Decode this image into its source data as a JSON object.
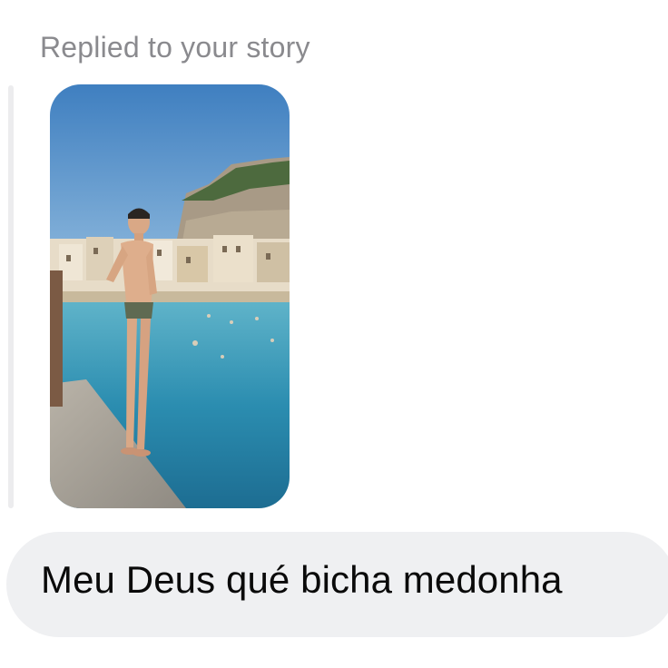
{
  "reply": {
    "header": "Replied to your story"
  },
  "story": {
    "thumbnail_icon": "story-photo-icon",
    "scene": "person standing on stone pier beside clear blue sea, town and rocky cliff in background"
  },
  "message": {
    "text": "Meu Deus qué bicha medonha"
  },
  "colors": {
    "header_text": "#8a8a8e",
    "reply_bar": "#ececee",
    "bubble_bg": "#eff0f2",
    "message_text": "#0a0a0a",
    "sky": "#4a86c4",
    "water": "#2f8fb0"
  }
}
